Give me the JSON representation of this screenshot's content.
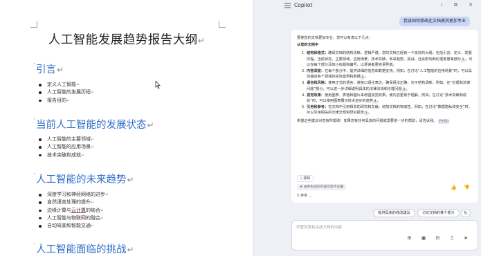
{
  "document": {
    "title": "人工智能发展趋势报告大纲",
    "para_mark": "↵",
    "list_mark": "↵",
    "sections": [
      {
        "heading": "引言",
        "items": [
          "定义人工智能",
          "人工智能的发展历程",
          "报告目的"
        ]
      },
      {
        "heading": "当前人工智能的发展状态",
        "items": [
          "人工智能的主要领域",
          "人工智能的应用场景",
          "技术突破和成就"
        ]
      },
      {
        "heading": "人工智能的未来趋势",
        "items": [
          "深度学习和神经网络的进步",
          "自然语言处理的提升",
          "边缘计算与云计算的结合",
          "人工智能与物联网的融合",
          "自动驾驶和智能交通"
        ]
      },
      {
        "heading": "人工智能面临的挑战",
        "items": []
      }
    ]
  },
  "copilot": {
    "title": "Copilot",
    "user_message": "我该如何修改此文档使其更加专业",
    "answer": {
      "intro": "要使您的文档更加专业，您可以考虑以下几点：",
      "section_label": "从您的文档中",
      "points": [
        {
          "num": "1.",
          "label": "结构和格式：",
          "text": "确保文档的结构清晰，逻辑严谨。您的文档已经有一个良好的大纲，包括引言、定义、发展历程、当前状态、主要领域、应用场景、技术突破、未来趋势、挑战、社会影响和伦理考量等部分",
          "cite": "1",
          "text2": "。可以在每个部分添加小标题和编号，以便读者更容易导航。"
        },
        {
          "num": "2.",
          "label": "内容深度：",
          "text": "在每个部分中，提供详细的信息和数据支持。例如，在讨论“人工智能的应用场景”时，可以具体描述各个领域的实际案例和数据",
          "cite": "2",
          "text2": "。"
        },
        {
          "num": "3.",
          "label": "语言和风格：",
          "text": "使用正式的语言，避免口语化表达。确保语法正确，句子结构清晰。例如，在“伦理和法律问题”部分，可以进一步详细说明具体的法律法规和伦理问题",
          "cite": "3",
          "text2": "。"
        },
        {
          "num": "4.",
          "label": "视觉效果：",
          "text": "使用图表、表格和图片来增强视觉效果，使内容更易于理解。例如，在讨论“技术突破和成就”时，可以使用图表展示技术进步的趋势",
          "cite": "4",
          "text2": "。"
        },
        {
          "num": "5.",
          "label": "引用和参考：",
          "text": "在文档中引用相关的研究和文献，增加文档的权威性。例如，在讨论“数据隐私和安全”时，可以引用相关的法律法规和研究报告",
          "cite": "5",
          "text2": "。"
        }
      ],
      "outro": "希望这些建议对您有所帮助！如果您有任何具体的问题或需要进一步的帮助，请告诉我。",
      "outro_cites": "[*]-[5]",
      "source_chip": "▯ 源码",
      "ai_chip": "★ 由AI生成的内容可能不正确",
      "refs": "5 参考 ⌄"
    },
    "suggestions": [
      "提供具体的修改建议",
      "讨论文档的某个部分"
    ],
    "refresh_icon": "↻",
    "input_placeholder": "尽管问我有关此文档的内容",
    "input_tools": "⊞ ▣ ⊟ ♫ ➤",
    "header_controls": "‹ ⧉ ✕",
    "feedback": "👍 👎"
  }
}
